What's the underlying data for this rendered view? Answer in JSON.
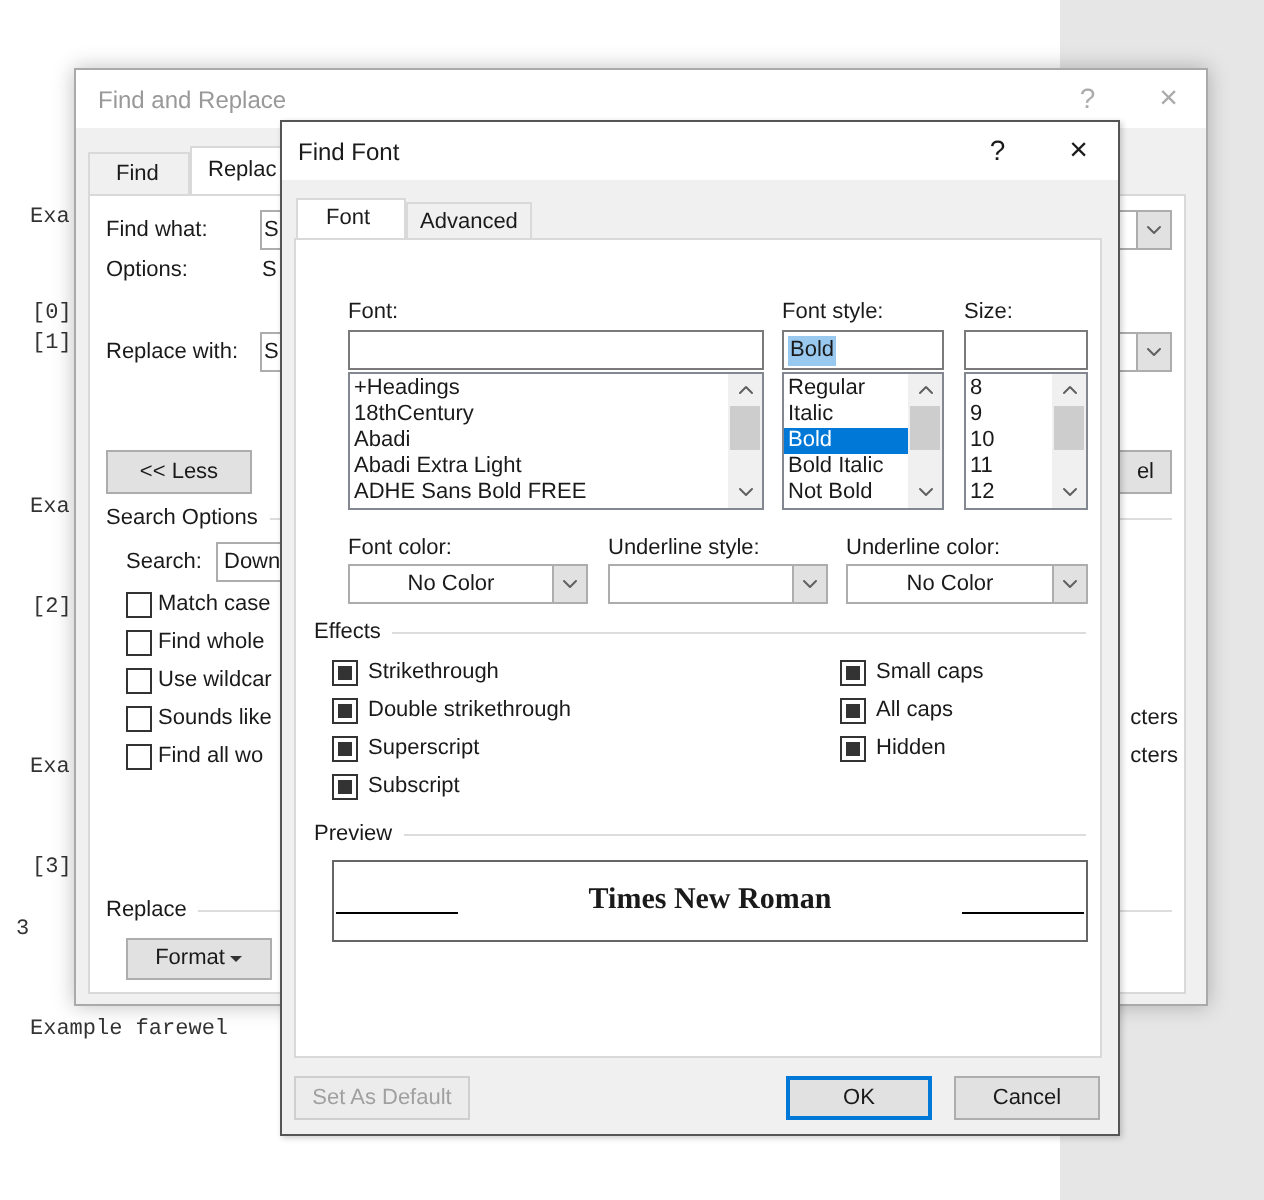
{
  "document": {
    "lines": [
      "Exa",
      "[0]",
      "[1]",
      "Exa",
      "[2]",
      "Exa",
      "[3]",
      "3",
      "Example farewel"
    ]
  },
  "find_replace": {
    "title": "Find and Replace",
    "help": "?",
    "close": "×",
    "tabs": [
      {
        "label": "Find",
        "selected": false
      },
      {
        "label": "Replac",
        "selected": true
      }
    ],
    "find_what": {
      "label": "Find what:",
      "value": "S"
    },
    "options": {
      "label": "Options:",
      "value": "S"
    },
    "replace_with": {
      "label": "Replace with:",
      "value": "S"
    },
    "less_button": "<< Less",
    "cancel_button": "el",
    "search_options": {
      "title": "Search Options",
      "search_label": "Search:",
      "search_value": "Down"
    },
    "checkboxes": [
      {
        "label": "Match case",
        "checked": false
      },
      {
        "label": "Find whole",
        "checked": false
      },
      {
        "label": "Use wildcar",
        "checked": false
      },
      {
        "label": "Sounds like",
        "checked": false,
        "right_text": "cters"
      },
      {
        "label": "Find all wo",
        "checked": false,
        "right_text": "cters"
      }
    ],
    "replace_section": "Replace",
    "format_button": "Format"
  },
  "find_font": {
    "title": "Find Font",
    "help": "?",
    "close": "×",
    "tabs": [
      {
        "label": "Font",
        "selected": true
      },
      {
        "label": "Advanced",
        "selected": false
      }
    ],
    "font": {
      "label": "Font:",
      "items": [
        {
          "label": "+Headings",
          "selected": false
        },
        {
          "label": "18thCentury",
          "selected": false
        },
        {
          "label": "Abadi",
          "selected": false
        },
        {
          "label": "Abadi Extra Light",
          "selected": false
        },
        {
          "label": "ADHE Sans Bold FREE",
          "selected": false
        }
      ]
    },
    "font_style": {
      "label": "Font style:",
      "value": "Bold",
      "items": [
        {
          "label": "Regular",
          "selected": false
        },
        {
          "label": "Italic",
          "selected": false
        },
        {
          "label": "Bold",
          "selected": true
        },
        {
          "label": "Bold Italic",
          "selected": false
        },
        {
          "label": "Not Bold",
          "selected": false
        }
      ]
    },
    "size": {
      "label": "Size:",
      "items": [
        {
          "label": "8",
          "selected": false
        },
        {
          "label": "9",
          "selected": false
        },
        {
          "label": "10",
          "selected": false
        },
        {
          "label": "11",
          "selected": false
        },
        {
          "label": "12",
          "selected": false
        }
      ]
    },
    "font_color": {
      "label": "Font color:",
      "value": "No Color"
    },
    "underline_style": {
      "label": "Underline style:"
    },
    "underline_color": {
      "label": "Underline color:",
      "value": "No Color"
    },
    "effects_title": "Effects",
    "effects_left": [
      {
        "label": "Strikethrough",
        "indeterminate": true
      },
      {
        "label": "Double strikethrough",
        "indeterminate": true
      },
      {
        "label": "Superscript",
        "indeterminate": true
      },
      {
        "label": "Subscript",
        "indeterminate": true
      }
    ],
    "effects_right": [
      {
        "label": "Small caps",
        "indeterminate": true
      },
      {
        "label": "All caps",
        "indeterminate": true
      },
      {
        "label": "Hidden",
        "indeterminate": true
      }
    ],
    "preview_title": "Preview",
    "preview_text": "Times New Roman",
    "buttons": [
      {
        "label": "Set As Default",
        "disabled": true,
        "default": false
      },
      {
        "label": "OK",
        "disabled": false,
        "default": true
      },
      {
        "label": "Cancel",
        "disabled": false,
        "default": false
      }
    ]
  }
}
